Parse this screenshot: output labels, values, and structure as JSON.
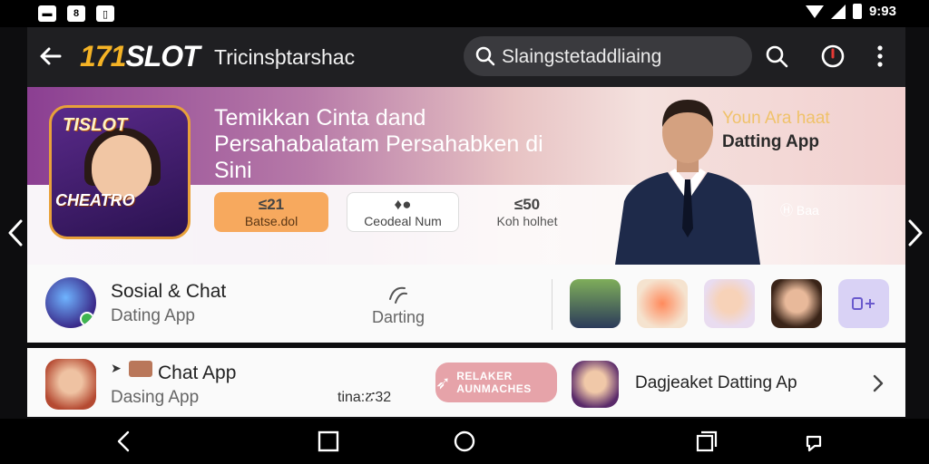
{
  "status_bar": {
    "time": "9:93"
  },
  "app_bar": {
    "logo_num": "171",
    "logo_text": "SLOT",
    "title": "Tricinsþtarshac",
    "search_value": "Slaingstetaddliaing"
  },
  "banner": {
    "game_title_top": "TISLOT",
    "game_title_bottom": "CHEATRO",
    "headline": "Temikkan Cinta dand Persahabalatam Persahabken di Sini",
    "pills": [
      {
        "value": "≤21",
        "label": "Batse.dol"
      },
      {
        "value": "♦●",
        "label": "Ceodeal Num"
      },
      {
        "value": "≤50",
        "label": "Koh holhet"
      }
    ],
    "promo_line1": "Youn Ara haat",
    "promo_line2": "Datting App",
    "promo_badge": "Ⓗ Baa"
  },
  "row1": {
    "title": "Sosial & Chat",
    "subtitle": "Dating App",
    "category_label": "Darting"
  },
  "row2": {
    "title": "Chat App",
    "subtitle": "Dasing App",
    "meta": "tina:ፘ32",
    "cta_label": "RELAKER AUNMACHES",
    "featured_title": "Dagjeaket Datting Ap"
  },
  "colors": {
    "accent": "#f5b325",
    "banner_start": "#8b3f92",
    "cta": "#e6a3a9"
  }
}
